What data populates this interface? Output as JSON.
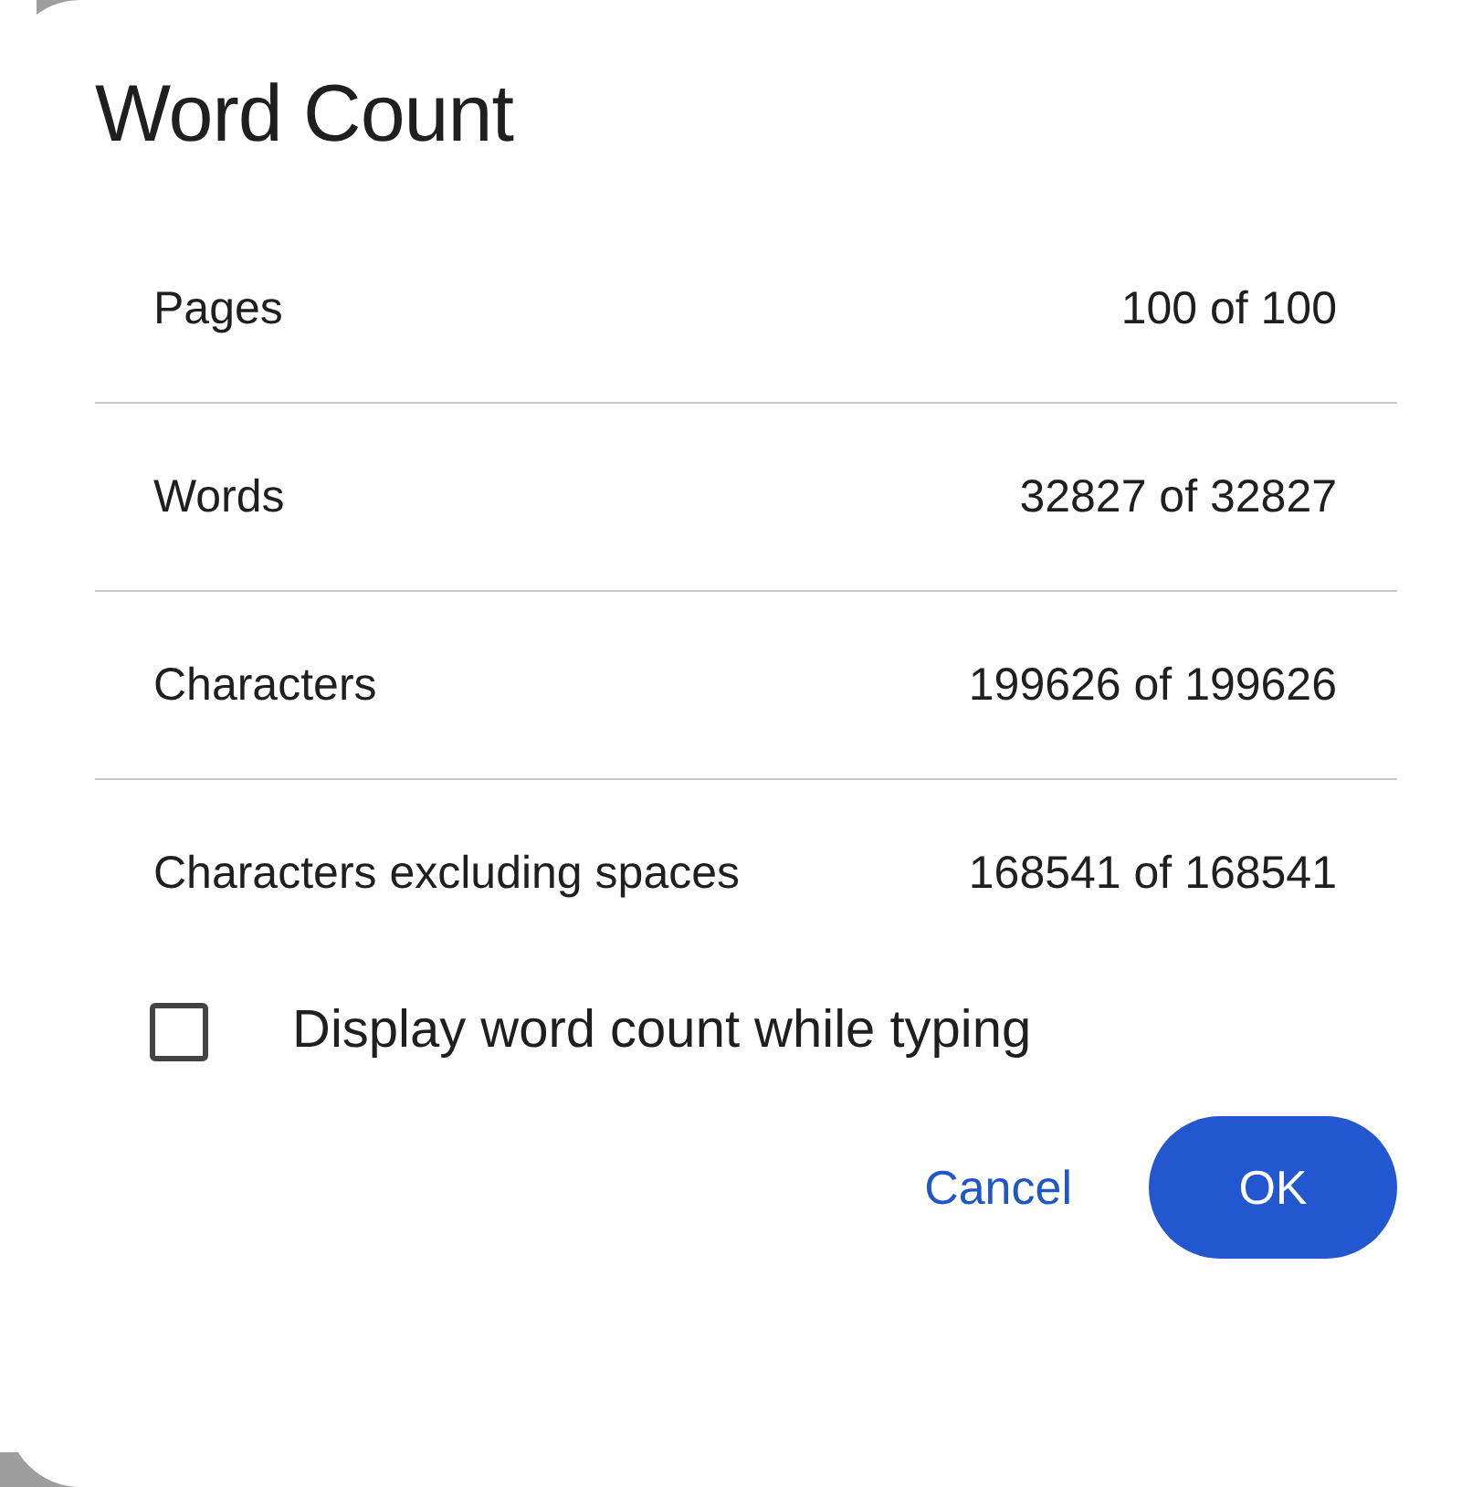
{
  "dialog": {
    "title": "Word Count"
  },
  "stats": [
    {
      "label": "Pages",
      "value": "100 of 100"
    },
    {
      "label": "Words",
      "value": "32827 of 32827"
    },
    {
      "label": "Characters",
      "value": "199626 of 199626"
    },
    {
      "label": "Characters excluding spaces",
      "value": "168541 of 168541"
    }
  ],
  "option": {
    "label": "Display word count while typing",
    "checked": false
  },
  "buttons": [
    {
      "label": "Cancel",
      "kind": "text"
    },
    {
      "label": "OK",
      "kind": "filled"
    }
  ]
}
